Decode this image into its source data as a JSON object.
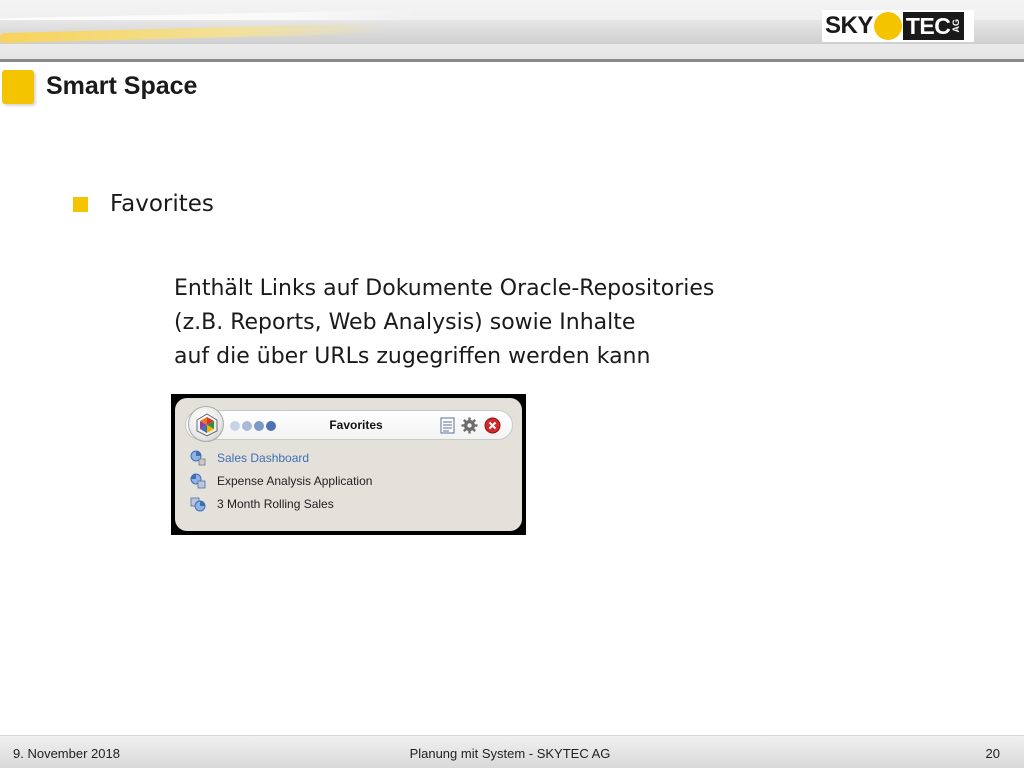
{
  "header": {
    "logo": {
      "left_text": "SKY",
      "right_text": "TEC",
      "suffix": "AG",
      "sun_color": "#f5c400"
    },
    "accent_color": "#f5c400"
  },
  "slide": {
    "title": "Smart Space",
    "bullet": "Favorites",
    "body_lines": [
      "Enthält Links auf Dokumente Oracle-Repositories",
      "(z.B. Reports, Web Analysis) sowie Inhalte",
      "auf die über URLs zugegriffen werden kann"
    ]
  },
  "widget": {
    "title": "Favorites",
    "icons": [
      "smartspace-logo-icon",
      "list-icon",
      "gear-icon",
      "close-icon"
    ],
    "items": [
      {
        "label": "Sales Dashboard",
        "icon": "dashboard-item-icon",
        "is_link": true
      },
      {
        "label": "Expense Analysis Application",
        "icon": "application-item-icon",
        "is_link": false
      },
      {
        "label": "3 Month Rolling Sales",
        "icon": "report-item-icon",
        "is_link": false
      }
    ]
  },
  "footer": {
    "date": "9. November 2018",
    "center": "Planung mit System - SKYTEC AG",
    "page_number": "20"
  }
}
